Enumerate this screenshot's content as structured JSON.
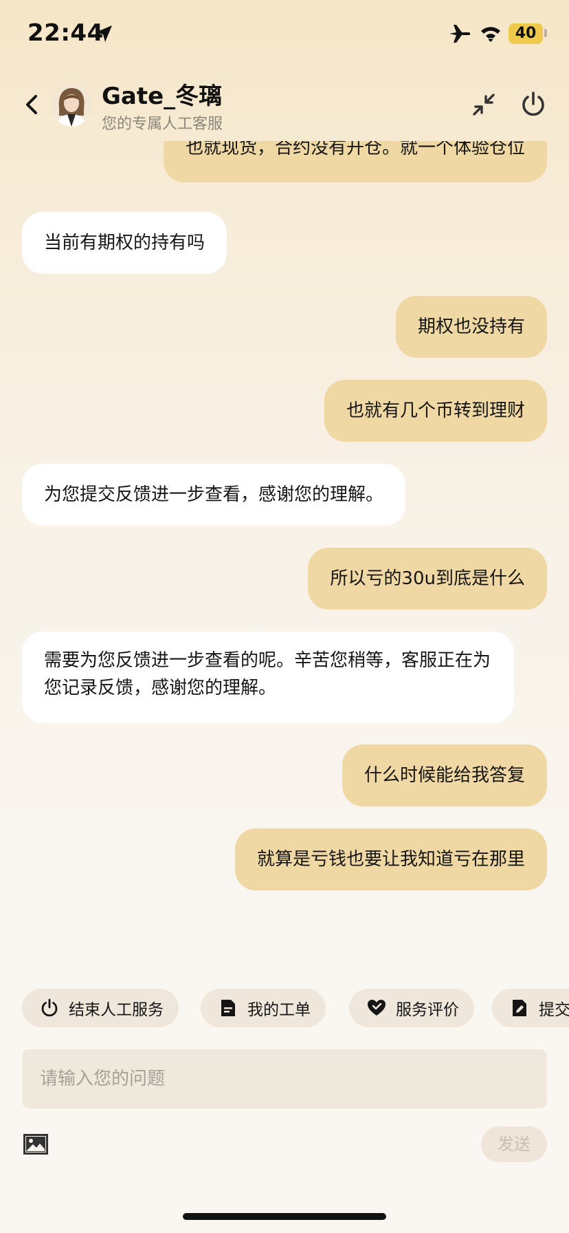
{
  "status_bar": {
    "time": "22:44",
    "battery": "40",
    "icons": [
      "location-arrow-icon",
      "airplane-icon",
      "wifi-icon",
      "battery-icon"
    ],
    "battery_color": "#efc94c"
  },
  "header": {
    "agent_name": "Gate_冬璃",
    "agent_subtitle": "您的专属人工客服",
    "icons": [
      "back-icon",
      "avatar",
      "minimize-icon",
      "power-icon"
    ]
  },
  "messages": [
    {
      "sender": "user",
      "text": "也就现货，合约没有开仓。就一个体验仓位"
    },
    {
      "sender": "agent",
      "text": "当前有期权的持有吗"
    },
    {
      "sender": "user",
      "text": "期权也没持有"
    },
    {
      "sender": "user",
      "text": "也就有几个币转到理财"
    },
    {
      "sender": "agent",
      "text": "为您提交反馈进一步查看，感谢您的理解。"
    },
    {
      "sender": "user",
      "text": "所以亏的30u到底是什么"
    },
    {
      "sender": "agent",
      "text": "需要为您反馈进一步查看的呢。辛苦您稍等，客服正在为您记录反馈，感谢您的理解。"
    },
    {
      "sender": "user",
      "text": "什么时候能给我答复"
    },
    {
      "sender": "user",
      "text": "就算是亏钱也要让我知道亏在那里"
    }
  ],
  "quick_actions": [
    {
      "label": "结束人工服务",
      "icon": "power-icon"
    },
    {
      "label": "我的工单",
      "icon": "ticket-icon"
    },
    {
      "label": "服务评价",
      "icon": "heart-rating-icon"
    },
    {
      "label": "提交",
      "icon": "edit-icon"
    }
  ],
  "input": {
    "placeholder": "请输入您的问题"
  },
  "send_button": "发送",
  "colors": {
    "user_bubble": "#efd8a4",
    "agent_bubble": "#ffffff",
    "chip_bg": "#efe7dc"
  }
}
